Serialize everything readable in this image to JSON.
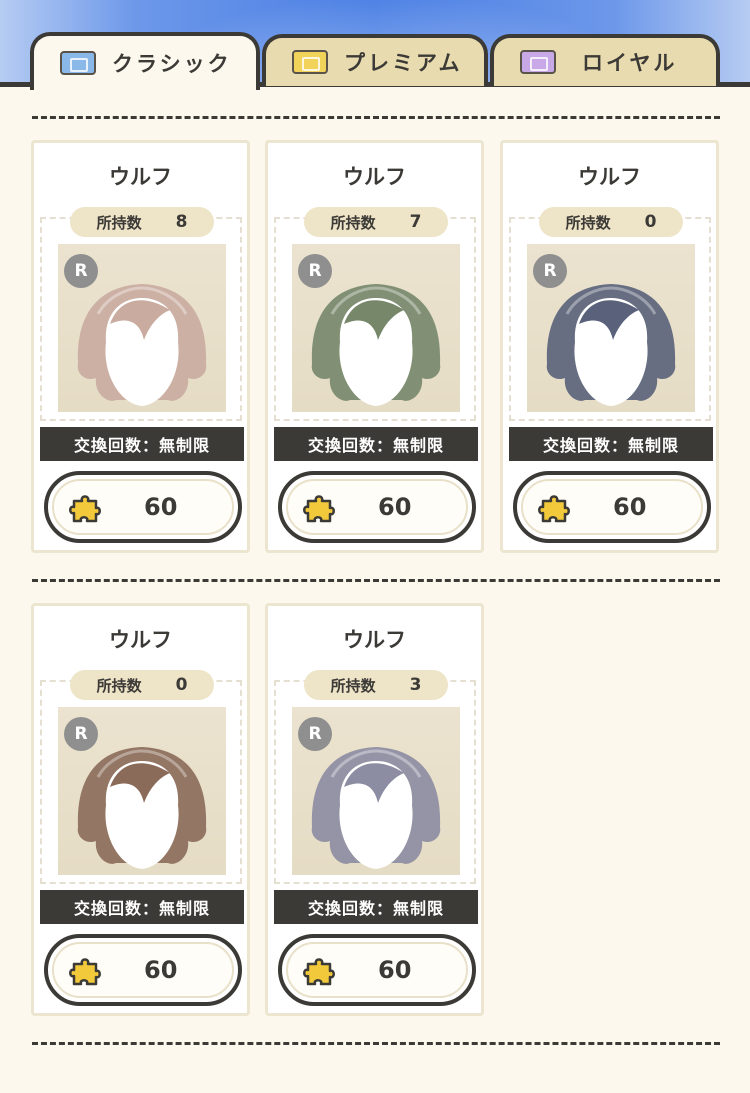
{
  "tabs": [
    {
      "label": "クラシック",
      "active": true,
      "ticket_color": "#8ab8e8"
    },
    {
      "label": "プレミアム",
      "active": false,
      "ticket_color": "#f2d35a"
    },
    {
      "label": "ロイヤル",
      "active": false,
      "ticket_color": "#c9a8e8"
    }
  ],
  "items": [
    {
      "name": "ウルフ",
      "owned_label": "所持数",
      "owned": "8",
      "rarity": "R",
      "hair_color": "#c9aba0",
      "limit": "交換回数：無制限",
      "price": "60"
    },
    {
      "name": "ウルフ",
      "owned_label": "所持数",
      "owned": "7",
      "rarity": "R",
      "hair_color": "#76876a",
      "limit": "交換回数：無制限",
      "price": "60"
    },
    {
      "name": "ウルフ",
      "owned_label": "所持数",
      "owned": "0",
      "rarity": "R",
      "hair_color": "#59627a",
      "limit": "交換回数：無制限",
      "price": "60"
    },
    {
      "name": "ウルフ",
      "owned_label": "所持数",
      "owned": "0",
      "rarity": "R",
      "hair_color": "#8a6a58",
      "limit": "交換回数：無制限",
      "price": "60"
    },
    {
      "name": "ウルフ",
      "owned_label": "所持数",
      "owned": "3",
      "rarity": "R",
      "hair_color": "#8c8ca2",
      "limit": "交換回数：無制限",
      "price": "60"
    }
  ],
  "colors": {
    "accent_dark": "#3c3a36",
    "card_bg": "#ffffff",
    "page_bg": "#fcf8ed",
    "piece": "#f2c93a"
  },
  "icons": {
    "tab": "ticket-icon",
    "rarity": "rarity-badge",
    "currency": "puzzle-piece-icon"
  }
}
